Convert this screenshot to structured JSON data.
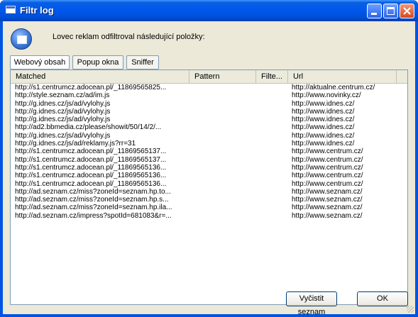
{
  "window": {
    "title": "Filtr log"
  },
  "info": {
    "message": "Lovec reklam odfiltroval následující položky:"
  },
  "tabs": [
    {
      "label": "Webový obsah",
      "active": true
    },
    {
      "label": "Popup okna",
      "active": false
    },
    {
      "label": "Sniffer",
      "active": false
    }
  ],
  "table": {
    "columns": [
      "Matched",
      "Pattern",
      "Filte...",
      "Url"
    ],
    "rows": [
      {
        "matched": "http://s1.centrumcz.adocean.pl/_11869565825...",
        "pattern": "",
        "filter": "",
        "url": "http://aktualne.centrum.cz/"
      },
      {
        "matched": "http://style.seznam.cz/ad/im.js",
        "pattern": "",
        "filter": "",
        "url": "http://www.novinky.cz/"
      },
      {
        "matched": "http://g.idnes.cz/js/ad/vylohy.js",
        "pattern": "",
        "filter": "",
        "url": "http://www.idnes.cz/"
      },
      {
        "matched": "http://g.idnes.cz/js/ad/vylohy.js",
        "pattern": "",
        "filter": "",
        "url": "http://www.idnes.cz/"
      },
      {
        "matched": "http://g.idnes.cz/js/ad/vylohy.js",
        "pattern": "",
        "filter": "",
        "url": "http://www.idnes.cz/"
      },
      {
        "matched": "http://ad2.bbmedia.cz/please/showit/50/14/2/...",
        "pattern": "",
        "filter": "",
        "url": "http://www.idnes.cz/"
      },
      {
        "matched": "http://g.idnes.cz/js/ad/vylohy.js",
        "pattern": "",
        "filter": "",
        "url": "http://www.idnes.cz/"
      },
      {
        "matched": "http://g.idnes.cz/js/ad/reklamy.js?rr=31",
        "pattern": "",
        "filter": "",
        "url": "http://www.idnes.cz/"
      },
      {
        "matched": "http://s1.centrumcz.adocean.pl/_11869565137...",
        "pattern": "",
        "filter": "",
        "url": "http://www.centrum.cz/"
      },
      {
        "matched": "http://s1.centrumcz.adocean.pl/_11869565137...",
        "pattern": "",
        "filter": "",
        "url": "http://www.centrum.cz/"
      },
      {
        "matched": "http://s1.centrumcz.adocean.pl/_11869565136...",
        "pattern": "",
        "filter": "",
        "url": "http://www.centrum.cz/"
      },
      {
        "matched": "http://s1.centrumcz.adocean.pl/_11869565136...",
        "pattern": "",
        "filter": "",
        "url": "http://www.centrum.cz/"
      },
      {
        "matched": "http://s1.centrumcz.adocean.pl/_11869565136...",
        "pattern": "",
        "filter": "",
        "url": "http://www.centrum.cz/"
      },
      {
        "matched": "http://ad.seznam.cz/miss?zoneId=seznam.hp.to...",
        "pattern": "",
        "filter": "",
        "url": "http://www.seznam.cz/"
      },
      {
        "matched": "http://ad.seznam.cz/miss?zoneId=seznam.hp.s...",
        "pattern": "",
        "filter": "",
        "url": "http://www.seznam.cz/"
      },
      {
        "matched": "http://ad.seznam.cz/miss?zoneId=seznam.hp.ila...",
        "pattern": "",
        "filter": "",
        "url": "http://www.seznam.cz/"
      },
      {
        "matched": "http://ad.seznam.cz/impress?spotId=681083&r=...",
        "pattern": "",
        "filter": "",
        "url": "http://www.seznam.cz/"
      }
    ]
  },
  "buttons": {
    "clear": "Vyčistit seznam",
    "ok": "OK"
  },
  "icons": {
    "title": "window-app-icon",
    "info": "info-app-icon",
    "minimize": "minimize-icon",
    "maximize": "maximize-icon",
    "close": "close-icon"
  }
}
